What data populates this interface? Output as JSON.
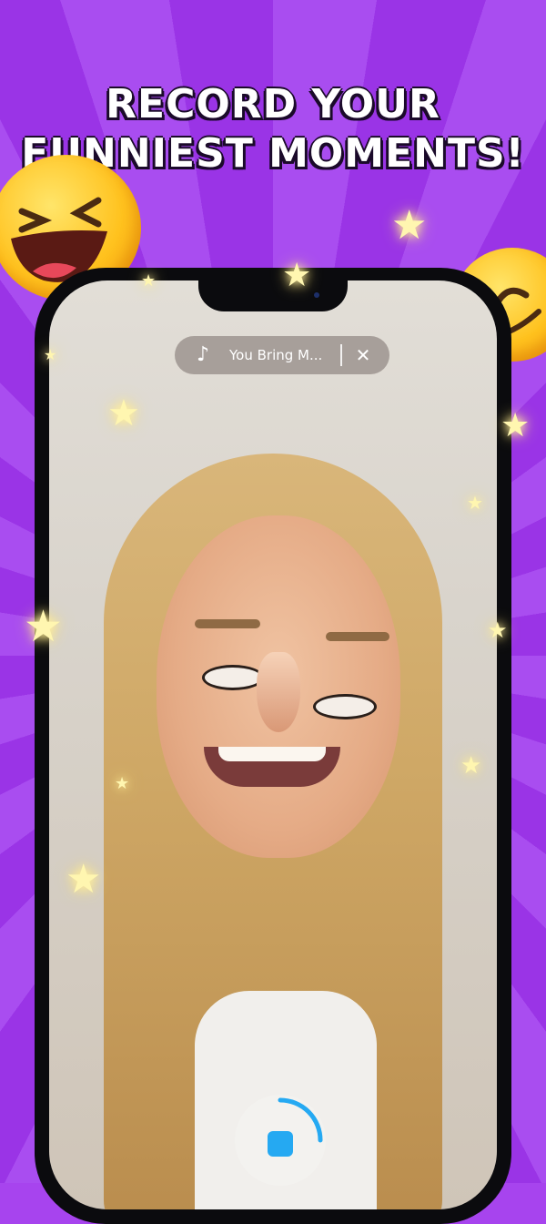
{
  "headline": {
    "line1": "RECORD YOUR",
    "line2": "FUNNIEST MOMENTS!"
  },
  "music": {
    "icon": "music-note-icon",
    "title": "You Bring M...",
    "close_icon": "close-icon"
  },
  "record": {
    "icon": "stop-icon",
    "accent": "#25A9F2"
  },
  "colors": {
    "background": "#A744EE",
    "phone_frame": "#0B0B0E",
    "star": "#FFF6B0"
  }
}
